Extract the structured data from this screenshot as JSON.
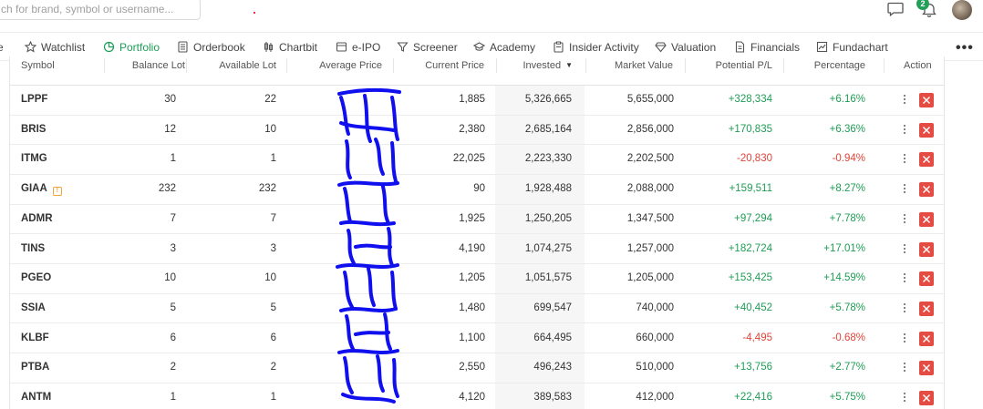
{
  "search": {
    "placeholder": "ch for brand, symbol or username..."
  },
  "notifications": {
    "count": "2"
  },
  "nav": {
    "items": [
      {
        "label": "e",
        "icon": "partial-icon"
      },
      {
        "label": "Watchlist",
        "icon": "star-icon"
      },
      {
        "label": "Portfolio",
        "icon": "pie-chart-icon",
        "active": true
      },
      {
        "label": "Orderbook",
        "icon": "book-icon"
      },
      {
        "label": "Chartbit",
        "icon": "candlestick-icon"
      },
      {
        "label": "e-IPO",
        "icon": "ipo-icon"
      },
      {
        "label": "Screener",
        "icon": "filter-icon"
      },
      {
        "label": "Academy",
        "icon": "academy-icon"
      },
      {
        "label": "Insider Activity",
        "icon": "clipboard-icon"
      },
      {
        "label": "Valuation",
        "icon": "diamond-icon"
      },
      {
        "label": "Financials",
        "icon": "document-icon"
      },
      {
        "label": "Fundachart",
        "icon": "chart-icon"
      }
    ],
    "more": "•••"
  },
  "table": {
    "headers": {
      "symbol": "Symbol",
      "balance_lot": "Balance Lot",
      "available_lot": "Available Lot",
      "average_price": "Average Price",
      "current_price": "Current Price",
      "invested": "Invested",
      "market_value": "Market Value",
      "potential_pl": "Potential P/L",
      "percentage": "Percentage",
      "action": "Action"
    },
    "sort": {
      "column": "invested",
      "direction": "desc"
    },
    "rows": [
      {
        "symbol": "LPPF",
        "balance_lot": "30",
        "available_lot": "22",
        "current_price": "1,885",
        "invested": "5,326,665",
        "market_value": "5,655,000",
        "potential_pl": "+328,334",
        "percentage": "+6.16%",
        "trend": "pos"
      },
      {
        "symbol": "BRIS",
        "balance_lot": "12",
        "available_lot": "10",
        "current_price": "2,380",
        "invested": "2,685,164",
        "market_value": "2,856,000",
        "potential_pl": "+170,835",
        "percentage": "+6.36%",
        "trend": "pos"
      },
      {
        "symbol": "ITMG",
        "balance_lot": "1",
        "available_lot": "1",
        "current_price": "22,025",
        "invested": "2,223,330",
        "market_value": "2,202,500",
        "potential_pl": "-20,830",
        "percentage": "-0.94%",
        "trend": "neg"
      },
      {
        "symbol": "GIAA",
        "badge": "!",
        "balance_lot": "232",
        "available_lot": "232",
        "current_price": "90",
        "invested": "1,928,488",
        "market_value": "2,088,000",
        "potential_pl": "+159,511",
        "percentage": "+8.27%",
        "trend": "pos"
      },
      {
        "symbol": "ADMR",
        "balance_lot": "7",
        "available_lot": "7",
        "current_price": "1,925",
        "invested": "1,250,205",
        "market_value": "1,347,500",
        "potential_pl": "+97,294",
        "percentage": "+7.78%",
        "trend": "pos"
      },
      {
        "symbol": "TINS",
        "balance_lot": "3",
        "available_lot": "3",
        "current_price": "4,190",
        "invested": "1,074,275",
        "market_value": "1,257,000",
        "potential_pl": "+182,724",
        "percentage": "+17.01%",
        "trend": "pos"
      },
      {
        "symbol": "PGEO",
        "balance_lot": "10",
        "available_lot": "10",
        "current_price": "1,205",
        "invested": "1,051,575",
        "market_value": "1,205,000",
        "potential_pl": "+153,425",
        "percentage": "+14.59%",
        "trend": "pos"
      },
      {
        "symbol": "SSIA",
        "balance_lot": "5",
        "available_lot": "5",
        "current_price": "1,480",
        "invested": "699,547",
        "market_value": "740,000",
        "potential_pl": "+40,452",
        "percentage": "+5.78%",
        "trend": "pos"
      },
      {
        "symbol": "KLBF",
        "balance_lot": "6",
        "available_lot": "6",
        "current_price": "1,100",
        "invested": "664,495",
        "market_value": "660,000",
        "potential_pl": "-4,495",
        "percentage": "-0.68%",
        "trend": "neg"
      },
      {
        "symbol": "PTBA",
        "balance_lot": "2",
        "available_lot": "2",
        "current_price": "2,550",
        "invested": "496,243",
        "market_value": "510,000",
        "potential_pl": "+13,756",
        "percentage": "+2.77%",
        "trend": "pos"
      },
      {
        "symbol": "ANTM",
        "balance_lot": "1",
        "available_lot": "1",
        "current_price": "4,120",
        "invested": "389,583",
        "market_value": "412,000",
        "potential_pl": "+22,416",
        "percentage": "+5.75%",
        "trend": "pos"
      }
    ]
  },
  "colors": {
    "accent": "#1d9d56",
    "positive": "#1f9d55",
    "negative": "#e0443a",
    "delete": "#e44b43",
    "redaction": "#1010ee"
  }
}
